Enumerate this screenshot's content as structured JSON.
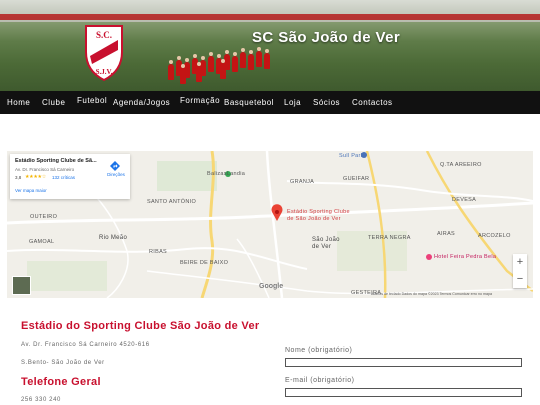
{
  "header": {
    "site_title": "SC São João de Ver",
    "badge_text_top": "S.C.",
    "badge_text_bottom": "S.J.V."
  },
  "nav": {
    "items": [
      {
        "label": "Home"
      },
      {
        "label": "Clube"
      },
      {
        "label": "Futebol"
      },
      {
        "label": "Agenda/Jogos"
      },
      {
        "label": "Formação"
      },
      {
        "label": "Basquetebol"
      },
      {
        "label": "Loja"
      },
      {
        "label": "Sócios"
      },
      {
        "label": "Contactos"
      }
    ]
  },
  "map": {
    "card": {
      "title": "Estádio Sporting Clube de Sã...",
      "address": "Av. Dr. Francisco Sá Carneiro",
      "rating": "3,8",
      "stars": "★★★★☆",
      "reviews": "132 críticas",
      "link": "Ver mapa maior",
      "directions": "Direções"
    },
    "labels": {
      "sull_park": "Sull Park",
      "q_tia_areeiro": "Q.TA AREEIRO",
      "balizas": "BalizasLandia",
      "granja": "GRANJA",
      "gueifar": "GUEIFAR",
      "devesa": "DEVESA",
      "sao_antonio": "SANTO ANTÓNIO",
      "pin": "Estádio Sporting Clube de São João de Ver",
      "outeiro": "OUTEIRO",
      "rio_meao": "Rio Meão",
      "gamoal": "GAMOAL",
      "ribas": "RIBAS",
      "terra_negra": "TERRA NEGRA",
      "airas": "AIRAS",
      "arcozelo": "ARCOZELO",
      "sao_joao": "São João de Ver",
      "beire": "BEIRE DE BAIXO",
      "hotel": "Hotel Feira Pedra Bela",
      "gesteira": "GESTEIRA",
      "google": "Google",
      "attribution": "Atalhos de teclado   Dados do mapa ©2023   Termos   Comunicar erro no mapa"
    },
    "zoom_in": "+",
    "zoom_out": "−"
  },
  "contact": {
    "stadium_heading": "Estádio do Sporting Clube São João de Ver",
    "address_line1": "Av. Dr. Francisco Sá Carneiro 4520-616",
    "address_line2": "S.Bento- São João de Ver",
    "phone_heading": "Telefone Geral",
    "phone": "256 330 240"
  },
  "form": {
    "name_label": "Nome (obrigatório)",
    "email_label": "E-mail (obrigatório)",
    "name_value": "",
    "email_value": ""
  },
  "colors": {
    "accent": "#c8102e",
    "nav_bg": "#111111"
  }
}
